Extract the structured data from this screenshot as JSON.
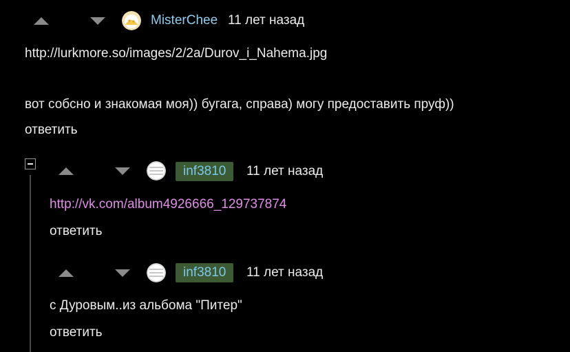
{
  "comments": [
    {
      "username": "MisterChee",
      "time": "11 лет назад",
      "line1": "http://lurkmore.so/images/2/2a/Durov_i_Nahema.jpg",
      "line2": "вот собсно и знакомая моя)) бугага, справа) могу предоставить пруф))",
      "reply": "ответить"
    },
    {
      "username": "inf3810",
      "time": "11 лет назад",
      "link": "http://vk.com/album4926666_129737874",
      "reply": "ответить"
    },
    {
      "username": "inf3810",
      "time": "11 лет назад",
      "text": "с Дуровым..из альбома \"Питер\"",
      "reply": "ответить"
    }
  ],
  "colors": {
    "background": "#000000",
    "text": "#ececec",
    "username_plain": "#8fcdf0",
    "username_badge_bg": "#3c5a34",
    "link": "#e08de8",
    "vote_arrow": "#8a8a8a"
  },
  "icons": [
    "upvote-icon",
    "downvote-icon",
    "collapse-icon"
  ]
}
